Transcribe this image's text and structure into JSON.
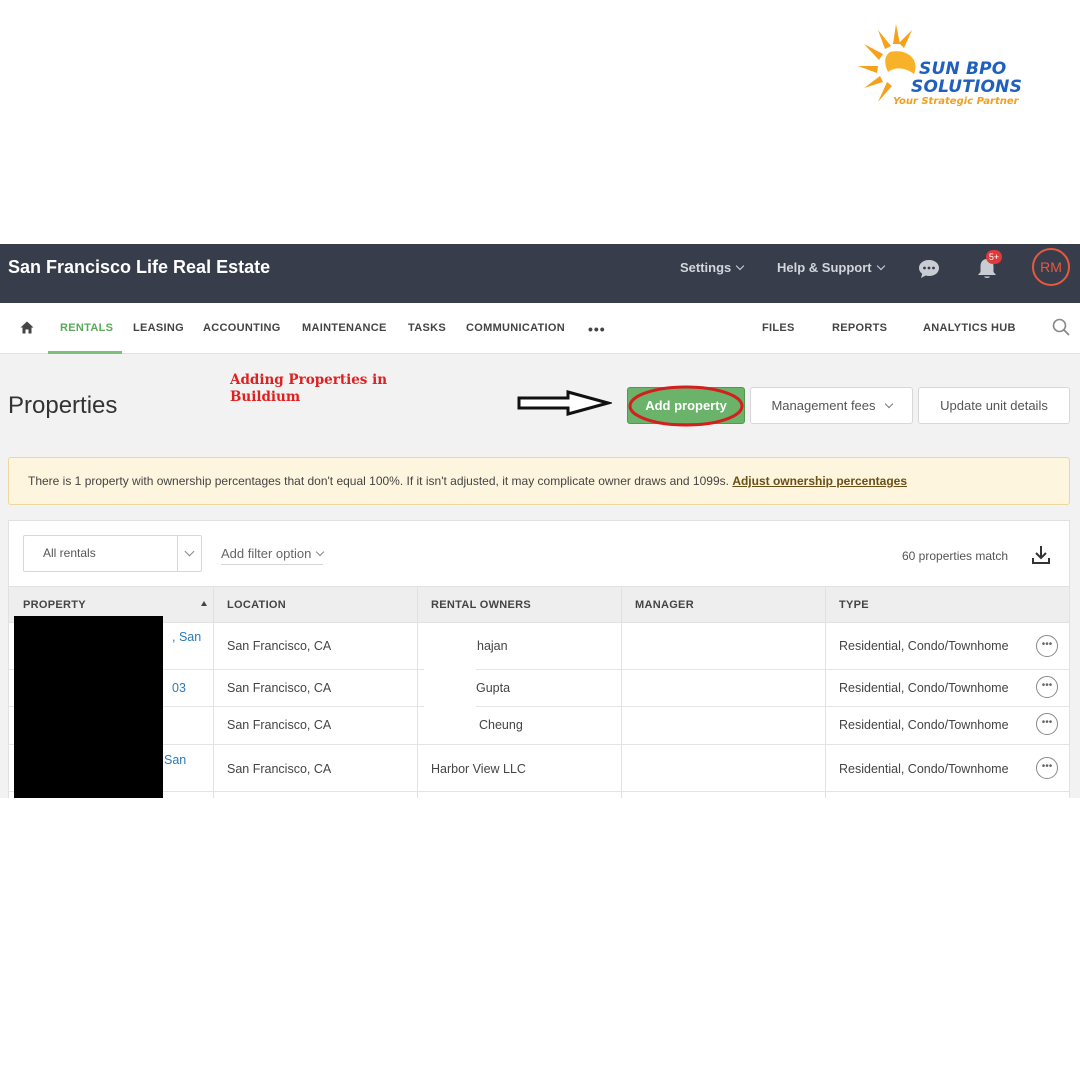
{
  "branding": {
    "line1": "SUN BPO",
    "line2": "SOLUTIONS",
    "tagline": "Your Strategic Partner",
    "icon": "sun-logo",
    "colors": {
      "primary": "#1f5fbf",
      "accent": "#f0a020"
    }
  },
  "annotation": {
    "text": "Adding Properties in Buildium",
    "color": "#e02020"
  },
  "header": {
    "company": "San Francisco Life Real Estate",
    "settings_label": "Settings",
    "help_label": "Help & Support",
    "notifications_badge": "5+",
    "avatar_initials": "RM",
    "colors": {
      "bar": "#373d4a",
      "avatar": "#e8583f"
    }
  },
  "nav": {
    "items": [
      "RENTALS",
      "LEASING",
      "ACCOUNTING",
      "MAINTENANCE",
      "TASKS",
      "COMMUNICATION"
    ],
    "more": "•••",
    "right_items": [
      "FILES",
      "REPORTS",
      "ANALYTICS HUB"
    ],
    "active": "RENTALS",
    "active_color": "#5aa95a"
  },
  "page": {
    "title": "Properties",
    "buttons": {
      "add": "Add property",
      "fees": "Management fees",
      "update": "Update unit details"
    },
    "primary_color": "#6bb26a"
  },
  "alert": {
    "text": "There is 1 property with ownership percentages that don't equal 100%. If it isn't adjusted, it may complicate owner draws and 1099s.",
    "link": "Adjust ownership percentages"
  },
  "filters": {
    "select_value": "All rentals",
    "add_filter": "Add filter option",
    "match_count": "60 properties match"
  },
  "table": {
    "columns": [
      "PROPERTY",
      "LOCATION",
      "RENTAL OWNERS",
      "MANAGER",
      "TYPE"
    ],
    "sorted_column": "PROPERTY",
    "rows": [
      {
        "property": ", San",
        "location": "San Francisco, CA",
        "owner": "hajan",
        "manager": "",
        "type": "Residential, Condo/Townhome"
      },
      {
        "property": "03",
        "location": "San Francisco, CA",
        "owner": "Gupta",
        "manager": "",
        "type": "Residential, Condo/Townhome"
      },
      {
        "property": "",
        "location": "San Francisco, CA",
        "owner": "Cheung",
        "manager": "",
        "type": "Residential, Condo/Townhome"
      },
      {
        "property": "San",
        "location": "San Francisco, CA",
        "owner": "Harbor View LLC",
        "manager": "",
        "type": "Residential, Condo/Townhome"
      }
    ]
  }
}
